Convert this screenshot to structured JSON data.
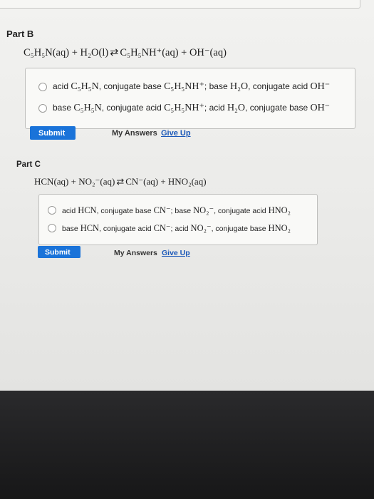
{
  "part_b": {
    "title": "Part B",
    "equation_left": "C₅H₅N(aq) + H₂O(l)",
    "equation_arrow": "⇄",
    "equation_right": "C₅H₅NH⁺(aq) + OH⁻(aq)",
    "choices": [
      {
        "prefix": "acid ",
        "acid": "C₅H₅N",
        "mid1": ", conjugate base ",
        "cbase": "C₅H₅NH⁺",
        "mid2": "; base ",
        "base": "H₂O",
        "mid3": ", conjugate acid ",
        "cacid": "OH⁻"
      },
      {
        "prefix": "base ",
        "acid": "C₅H₅N",
        "mid1": ", conjugate acid ",
        "cbase": "C₅H₅NH⁺",
        "mid2": "; acid ",
        "base": "H₂O",
        "mid3": ", conjugate base ",
        "cacid": "OH⁻"
      }
    ],
    "submit_label": "Submit",
    "my_answers_label": "My Answers",
    "give_up_label": "Give Up"
  },
  "part_c": {
    "title": "Part C",
    "equation_left": "HCN(aq) + NO₂⁻(aq)",
    "equation_arrow": "⇄",
    "equation_right": "CN⁻(aq) + HNO₂(aq)",
    "choices": [
      {
        "prefix": "acid ",
        "acid": "HCN",
        "mid1": ", conjugate base ",
        "cbase": "CN⁻",
        "mid2": "; base ",
        "base": "NO₂⁻",
        "mid3": ", conjugate acid ",
        "cacid": "HNO₂"
      },
      {
        "prefix": "base ",
        "acid": "HCN",
        "mid1": ", conjugate acid ",
        "cbase": "CN⁻",
        "mid2": "; acid ",
        "base": "NO₂⁻",
        "mid3": ", conjugate base ",
        "cacid": "HNO₂"
      }
    ],
    "submit_label": "Submit",
    "my_answers_label": "My Answers",
    "give_up_label": "Give Up"
  },
  "colors": {
    "submit_bg": "#1a73d9",
    "link": "#1b58b8"
  }
}
